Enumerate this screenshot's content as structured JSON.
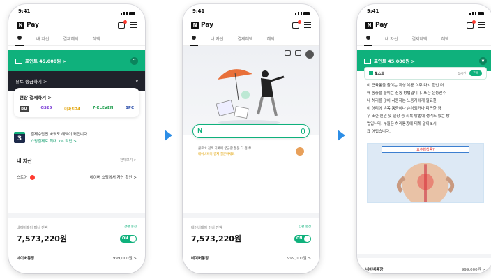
{
  "phones": [
    {
      "status": {
        "time": "9:41"
      },
      "header": {
        "logo": "Pay",
        "logo_mark": "N"
      },
      "tabs": [
        "내 자산",
        "결제혜택",
        "혜택"
      ],
      "green_card": {
        "text": "포인트 45,000원 >"
      },
      "dark_card": {
        "text": "뮤토 송금하기 >"
      },
      "pay_card": {
        "title": "현장 결제하기 >",
        "brands": [
          "BU",
          "GS25",
          "이마트24",
          "7-ELEVEN",
          "SPC"
        ]
      },
      "promo": {
        "line1": "결제수단만 바꿔도 혜택이 커집니다",
        "line2": "쇼핑결제로 최대 3% 적립 >"
      },
      "my_assets": {
        "title": "내 자산",
        "more": "전체보기 >"
      },
      "list_row": {
        "label": "스토어 ",
        "value": "네이버 쇼핑에서 자산 확인 >"
      },
      "asset": {
        "label": "네이버페이 머니 잔액",
        "amount": "7,573,220원",
        "toggle_caption": "간편 충전",
        "toggle": "ON",
        "bottom_label": "네이버통장",
        "bottom_value": "999,000원 >"
      }
    },
    {
      "status": {
        "time": "9:41"
      },
      "header": {
        "logo": "Pay",
        "logo_mark": "N"
      },
      "tabs": [
        "내 자산",
        "결제혜택",
        "혜택"
      ],
      "search": {
        "mark": "N"
      },
      "suggest": {
        "line1": "클로바 검색 기록에 궁금한 질문 다 검색!",
        "line2": "네이버페이 결제 질문하세요"
      },
      "asset": {
        "label": "네이버페이 머니 잔액",
        "amount": "7,573,220원",
        "toggle_caption": "간편 충전",
        "toggle": "ON",
        "bottom_label": "네이버통장",
        "bottom_value": "999,000원 >"
      }
    },
    {
      "status": {
        "time": "9:41"
      },
      "header": {
        "logo": "Pay",
        "logo_mark": "N"
      },
      "tabs": [
        "내 자산",
        "결제혜택",
        "혜택"
      ],
      "green_card": {
        "text": "포인트 45,000원 >"
      },
      "article": {
        "source": "포스트",
        "tag": "1시간",
        "pill": "구독",
        "lines": [
          "이 근육통을 줄이는 특성 복용 이후 다시 한번 더",
          "해 통증을 줄이는 진통 방법입니다. 또한 운동선수",
          "나 허리를 많이 사용하는 노동자에게 필요한",
          "이 허리에 손목 통증이나 손상되거나 피곤한 경",
          "우 또한 원인 및 일상 등 회복 방법에 생겨도 있는 방",
          "법입니다. 부들은 허리통증에 대해 알아보시",
          "죠 어렵습니다."
        ],
        "image_caption": "요추협착증?"
      },
      "asset": {
        "bottom_label": "네이버통장",
        "bottom_value": "999,000원 >"
      }
    }
  ],
  "colors": {
    "green": "#0fb17c",
    "dark": "#20222b",
    "arrow": "#2d8ee6"
  }
}
